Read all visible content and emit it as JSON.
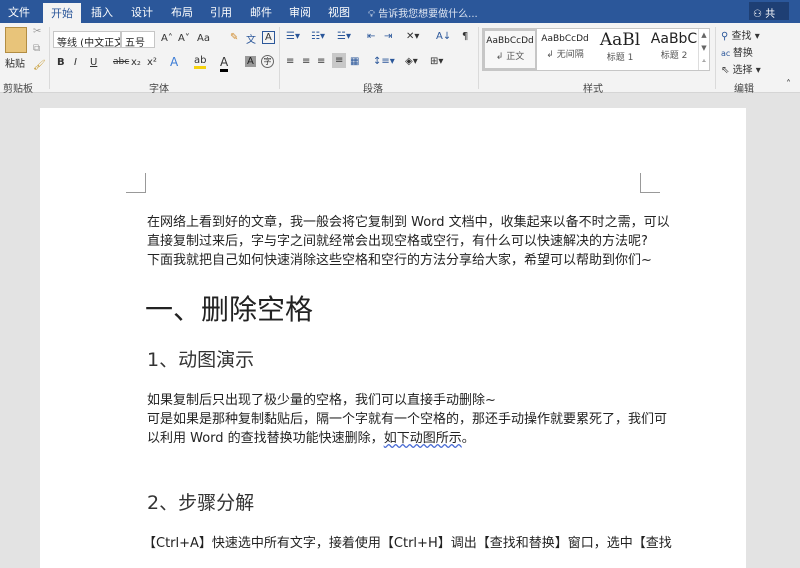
{
  "tabs": [
    "文件",
    "开始",
    "插入",
    "设计",
    "布局",
    "引用",
    "邮件",
    "审阅",
    "视图"
  ],
  "tell_me": "告诉我您想要做什么...",
  "share": "共享",
  "clipboard": {
    "paste": "粘贴",
    "label": "剪贴板"
  },
  "font": {
    "name": "等线 (中文正文",
    "size": "五号",
    "label": "字体",
    "change_case": "Aa"
  },
  "paragraph": {
    "label": "段落"
  },
  "styles": {
    "label": "样式",
    "items": [
      {
        "sample": "AaBbCcDd",
        "name": "↲ 正文"
      },
      {
        "sample": "AaBbCcDd",
        "name": "↲ 无间隔"
      },
      {
        "sample": "AaBl",
        "name": "标题 1"
      },
      {
        "sample": "AaBbC",
        "name": "标题 2"
      }
    ]
  },
  "editing": {
    "label": "编辑",
    "find": "查找",
    "replace": "替换",
    "select": "选择"
  },
  "doc": {
    "intro": [
      "在网络上看到好的文章，我一般会将它复制到 Word 文档中，收集起来以备不时之需，可以",
      "直接复制过来后，字与字之间就经常会出现空格或空行，有什么可以快速解决的方法呢?",
      "下面我就把自己如何快速消除这些空格和空行的方法分享给大家，希望可以帮助到你们~"
    ],
    "h1": "一、删除空格",
    "h2a": "1、动图演示",
    "para2": [
      "如果复制后只出现了极少量的空格，我们可以直接手动删除~",
      "可是如果是那种复制黏贴后，隔一个字就有一个空格的，那还手动操作就要累死了，我们可",
      "以利用 Word 的查找替换功能快速删除，"
    ],
    "para2_link": "如下动图所示",
    "para2_end": "。",
    "h2b": "2、步骤分解",
    "para3": "【Ctrl+A】快速选中所有文字，接着使用【Ctrl+H】调出【查找和替换】窗口，选中【查找"
  }
}
